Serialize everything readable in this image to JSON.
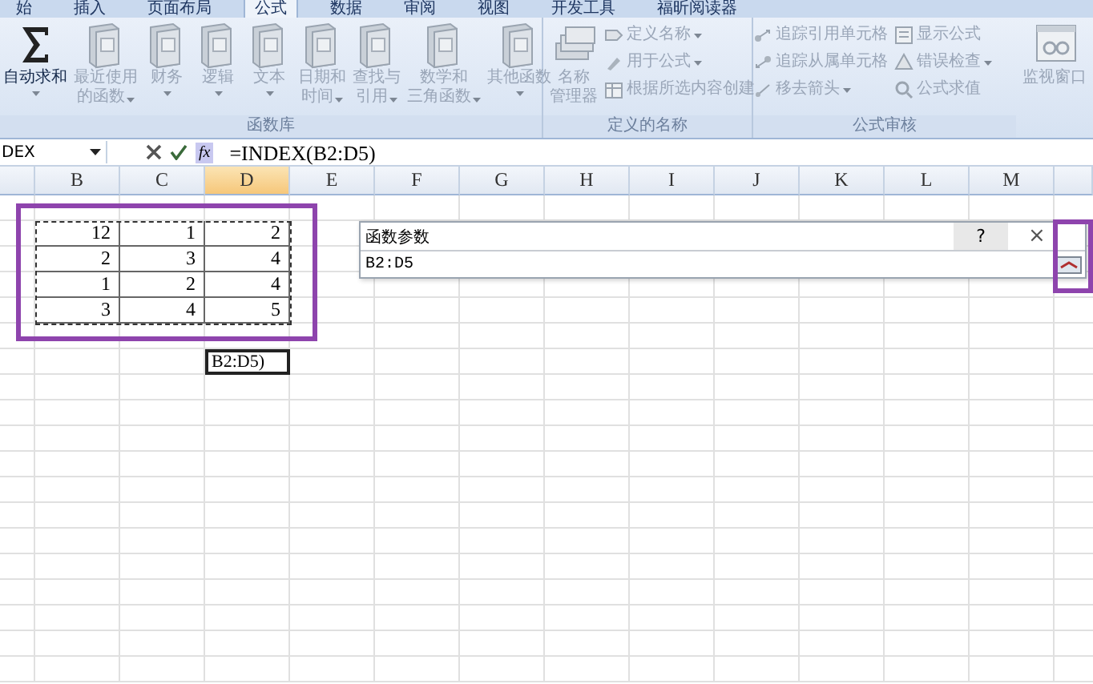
{
  "tabs": [
    {
      "label": "始",
      "selected": false
    },
    {
      "label": "插入",
      "selected": false
    },
    {
      "label": "页面布局",
      "selected": false
    },
    {
      "label": "公式",
      "selected": true
    },
    {
      "label": "数据",
      "selected": false
    },
    {
      "label": "审阅",
      "selected": false
    },
    {
      "label": "视图",
      "selected": false
    },
    {
      "label": "开发工具",
      "selected": false
    },
    {
      "label": "福昕阅读器",
      "selected": false
    }
  ],
  "ribbon": {
    "groups": [
      {
        "title": "函数库",
        "large": [
          {
            "lines": [
              "自动求和"
            ],
            "disabled": false,
            "dropdown": true
          },
          {
            "lines": [
              "最近使用",
              "的函数"
            ],
            "disabled": true,
            "dropdown": true
          },
          {
            "lines": [
              "财务"
            ],
            "disabled": true,
            "dropdown": true
          },
          {
            "lines": [
              "逻辑"
            ],
            "disabled": true,
            "dropdown": true
          },
          {
            "lines": [
              "文本"
            ],
            "disabled": true,
            "dropdown": true
          },
          {
            "lines": [
              "日期和",
              "时间"
            ],
            "disabled": true,
            "dropdown": true
          },
          {
            "lines": [
              "查找与",
              "引用"
            ],
            "disabled": true,
            "dropdown": true
          },
          {
            "lines": [
              "数学和",
              "三角函数"
            ],
            "disabled": true,
            "dropdown": true
          },
          {
            "lines": [
              "其他函数"
            ],
            "disabled": true,
            "dropdown": true
          }
        ]
      },
      {
        "title": "定义的名称",
        "large": [
          {
            "lines": [
              "名称",
              "管理器"
            ],
            "disabled": true,
            "dropdown": false
          }
        ],
        "small": [
          {
            "label": "定义名称",
            "disabled": true,
            "dropdown": true
          },
          {
            "label": "用于公式",
            "disabled": true,
            "dropdown": true
          },
          {
            "label": "根据所选内容创建",
            "disabled": true,
            "dropdown": false
          }
        ]
      },
      {
        "title": "公式审核",
        "small": [
          {
            "label": "追踪引用单元格",
            "disabled": true,
            "dropdown": false
          },
          {
            "label": "追踪从属单元格",
            "disabled": true,
            "dropdown": false
          },
          {
            "label": "移去箭头",
            "disabled": true,
            "dropdown": true
          },
          {
            "label": "显示公式",
            "disabled": true,
            "dropdown": false
          },
          {
            "label": "错误检查",
            "disabled": true,
            "dropdown": true
          },
          {
            "label": "公式求值",
            "disabled": true,
            "dropdown": false
          }
        ]
      },
      {
        "large": [
          {
            "lines": [
              "监视窗口"
            ],
            "disabled": true,
            "dropdown": false
          }
        ]
      }
    ]
  },
  "formula_bar": {
    "name_box": "DEX",
    "insert_function": "fx",
    "formula": "=INDEX(B2:D5)"
  },
  "sheet": {
    "columns": [
      {
        "label": "B",
        "selected": false
      },
      {
        "label": "C",
        "selected": false
      },
      {
        "label": "D",
        "selected": true
      },
      {
        "label": "E",
        "selected": false
      },
      {
        "label": "F",
        "selected": false
      },
      {
        "label": "G",
        "selected": false
      },
      {
        "label": "H",
        "selected": false
      },
      {
        "label": "I",
        "selected": false
      },
      {
        "label": "J",
        "selected": false
      },
      {
        "label": "K",
        "selected": false
      },
      {
        "label": "L",
        "selected": false
      },
      {
        "label": "M",
        "selected": false
      }
    ],
    "data_rows": [
      [
        "12",
        "1",
        "2"
      ],
      [
        "2",
        "3",
        "4"
      ],
      [
        "1",
        "2",
        "4"
      ],
      [
        "3",
        "4",
        "5"
      ]
    ],
    "edit_cell": "B2:D5)"
  },
  "dialog": {
    "title": "函数参数",
    "help": "?",
    "close": "×",
    "value": "B2:D5"
  }
}
